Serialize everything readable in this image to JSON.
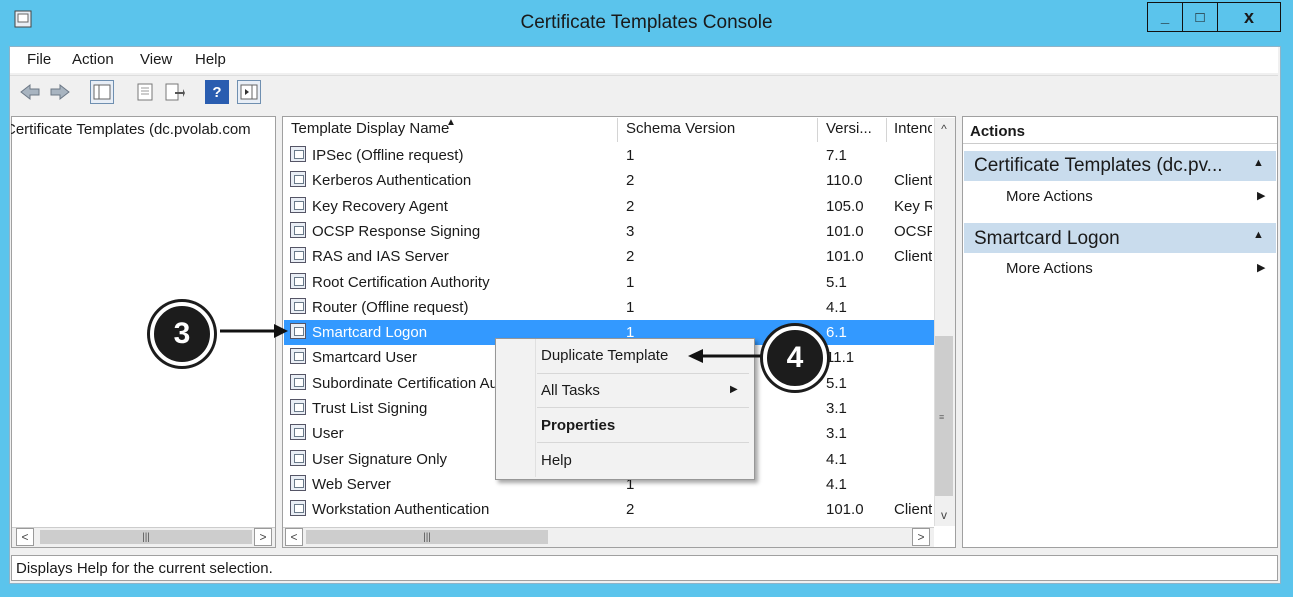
{
  "window": {
    "title": "Certificate Templates Console",
    "minimize": "_",
    "maximize": "□",
    "close": "x"
  },
  "menu": [
    "File",
    "Action",
    "View",
    "Help"
  ],
  "toolbar": {
    "icons": [
      "back-arrow-icon",
      "forward-arrow-icon",
      "show-hide-tree-icon",
      "properties-icon",
      "export-list-icon",
      "help-icon",
      "show-hide-action-pane-icon"
    ],
    "help_glyph": "?"
  },
  "tree": {
    "root": "Certificate Templates (dc.pvolab.com"
  },
  "list": {
    "columns": [
      "Template Display Name",
      "Schema Version",
      "Versi...",
      "Intend"
    ],
    "rows": [
      {
        "name": "IPSec (Offline request)",
        "schema": "1",
        "version": "7.1",
        "intended": ""
      },
      {
        "name": "Kerberos Authentication",
        "schema": "2",
        "version": "110.0",
        "intended": "Client"
      },
      {
        "name": "Key Recovery Agent",
        "schema": "2",
        "version": "105.0",
        "intended": "Key R"
      },
      {
        "name": "OCSP Response Signing",
        "schema": "3",
        "version": "101.0",
        "intended": "OCSP"
      },
      {
        "name": "RAS and IAS Server",
        "schema": "2",
        "version": "101.0",
        "intended": "Client"
      },
      {
        "name": "Root Certification Authority",
        "schema": "1",
        "version": "5.1",
        "intended": ""
      },
      {
        "name": "Router (Offline request)",
        "schema": "1",
        "version": "4.1",
        "intended": ""
      },
      {
        "name": "Smartcard Logon",
        "schema": "1",
        "version": "6.1",
        "intended": "",
        "selected": true
      },
      {
        "name": "Smartcard User",
        "schema": "",
        "version": "11.1",
        "intended": ""
      },
      {
        "name": "Subordinate Certification Authority",
        "schema": "",
        "version": "5.1",
        "intended": ""
      },
      {
        "name": "Trust List Signing",
        "schema": "",
        "version": "3.1",
        "intended": ""
      },
      {
        "name": "User",
        "schema": "",
        "version": "3.1",
        "intended": ""
      },
      {
        "name": "User Signature Only",
        "schema": "",
        "version": "4.1",
        "intended": ""
      },
      {
        "name": "Web Server",
        "schema": "1",
        "version": "4.1",
        "intended": ""
      },
      {
        "name": "Workstation Authentication",
        "schema": "2",
        "version": "101.0",
        "intended": "Client"
      }
    ]
  },
  "context_menu": {
    "items": [
      "Duplicate Template",
      "All Tasks",
      "Properties",
      "Help"
    ]
  },
  "actions": {
    "title": "Actions",
    "groups": [
      {
        "label": "Certificate Templates (dc.pv...",
        "item": "More Actions"
      },
      {
        "label": "Smartcard Logon",
        "item": "More Actions"
      }
    ]
  },
  "status": "Displays Help for the current selection.",
  "callouts": [
    "3",
    "4"
  ]
}
